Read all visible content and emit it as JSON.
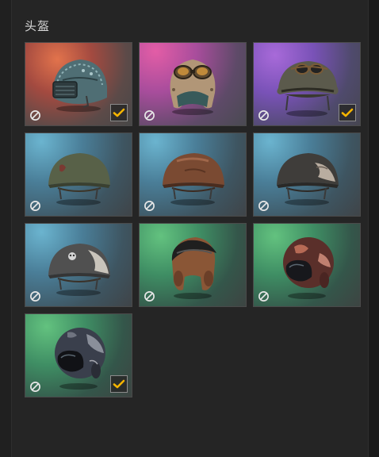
{
  "section": {
    "title": "头盔"
  },
  "colors": {
    "check": "#f5b400",
    "banned_icon": "#e6e6e6"
  },
  "items": [
    {
      "name": "level-3-spetsnaz-helmet",
      "rarity_bg": "red",
      "equipped": true
    },
    {
      "name": "aviator-goggles-cap-helmet",
      "rarity_bg": "magenta",
      "equipped": false
    },
    {
      "name": "goggles-steel-helmet",
      "rarity_bg": "purple",
      "equipped": true
    },
    {
      "name": "olive-military-helmet",
      "rarity_bg": "blue",
      "equipped": false
    },
    {
      "name": "brown-leather-military-helmet",
      "rarity_bg": "blue",
      "equipped": false
    },
    {
      "name": "worn-camo-military-helmet",
      "rarity_bg": "blue",
      "equipped": false
    },
    {
      "name": "skull-emblem-military-helmet",
      "rarity_bg": "blue",
      "equipped": false
    },
    {
      "name": "visor-riding-helmet-brown",
      "rarity_bg": "green",
      "equipped": false
    },
    {
      "name": "visor-riding-helmet-red-camo",
      "rarity_bg": "green",
      "equipped": false
    },
    {
      "name": "visor-riding-helmet-dark-camo",
      "rarity_bg": "green",
      "equipped": true
    }
  ]
}
